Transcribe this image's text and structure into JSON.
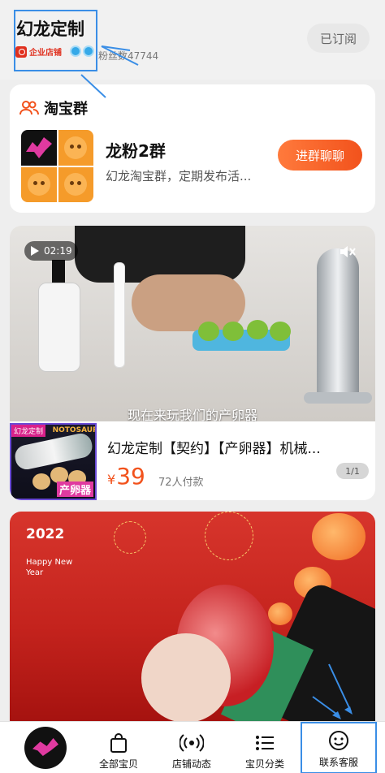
{
  "header": {
    "shop_name": "幻龙定制",
    "enterprise_badge": "企业店铺",
    "fans_text": "粉丝数47744",
    "follow_button": "已订阅"
  },
  "group_section": {
    "title": "淘宝群",
    "group_name": "龙粉2群",
    "group_desc": "幻龙淘宝群，定期发布活...",
    "join_button": "进群聊聊"
  },
  "video_card": {
    "duration": "02:19",
    "subtitle": "现在来玩我们的产卵器",
    "thumb_tag": "幻龙定制",
    "thumb_brand": "NOTOSAUR",
    "thumb_label": "产卵器",
    "product_title": "幻龙定制【契约】【产卵器】机械...",
    "currency": "¥",
    "price": "39",
    "sold": "72人付款",
    "page_indicator": "1/1"
  },
  "banner": {
    "year": "2022",
    "greeting": "Happy New Year"
  },
  "tabbar": {
    "items": [
      {
        "label": "全部宝贝",
        "icon": "shopping-bag-icon"
      },
      {
        "label": "店铺动态",
        "icon": "broadcast-icon"
      },
      {
        "label": "宝贝分类",
        "icon": "category-list-icon"
      },
      {
        "label": "联系客服",
        "icon": "customer-service-icon"
      }
    ]
  },
  "colors": {
    "accent": "#f2521c",
    "annotation": "#3a8ee6"
  }
}
